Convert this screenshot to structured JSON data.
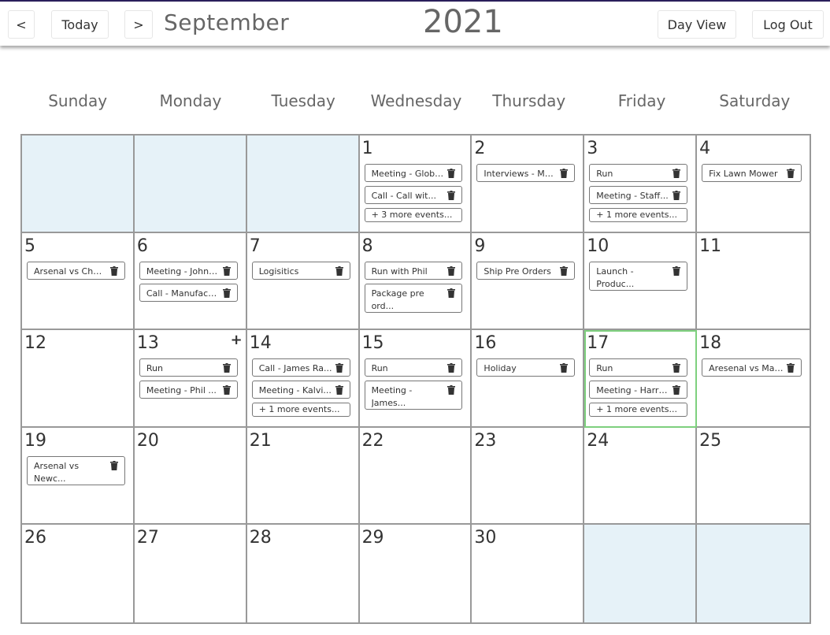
{
  "header": {
    "prev_label": "<",
    "today_label": "Today",
    "next_label": ">",
    "month": "September",
    "year": "2021",
    "day_view_label": "Day View",
    "logout_label": "Log Out"
  },
  "weekdays": [
    "Sunday",
    "Monday",
    "Tuesday",
    "Wednesday",
    "Thursday",
    "Friday",
    "Saturday"
  ],
  "colors": {
    "empty_cell": "#e6f2f8",
    "today_border": "#7ed07e",
    "header_line": "#2b1f5c"
  },
  "cells": [
    {
      "day": "",
      "empty": true,
      "events": []
    },
    {
      "day": "",
      "empty": true,
      "events": []
    },
    {
      "day": "",
      "empty": true,
      "events": []
    },
    {
      "day": "1",
      "events": [
        {
          "label": "Meeting - Globa..."
        },
        {
          "label": "Call - Call wit..."
        }
      ],
      "more": "+ 3 more events..."
    },
    {
      "day": "2",
      "events": [
        {
          "label": "Interviews - Me..."
        }
      ]
    },
    {
      "day": "3",
      "events": [
        {
          "label": "Run"
        },
        {
          "label": "Meeting - Staff..."
        }
      ],
      "more": "+ 1 more events..."
    },
    {
      "day": "4",
      "events": [
        {
          "label": "Fix Lawn Mower"
        }
      ]
    },
    {
      "day": "5",
      "events": [
        {
          "label": "Arsenal vs Chel..."
        }
      ]
    },
    {
      "day": "6",
      "events": [
        {
          "label": "Meeting - John ..."
        },
        {
          "label": "Call - Manufact..."
        }
      ]
    },
    {
      "day": "7",
      "events": [
        {
          "label": "Logisitics"
        }
      ]
    },
    {
      "day": "8",
      "events": [
        {
          "label": "Run with Phil"
        },
        {
          "label": "Package pre ord...",
          "tall": true
        }
      ]
    },
    {
      "day": "9",
      "events": [
        {
          "label": "Ship Pre Orders"
        }
      ]
    },
    {
      "day": "10",
      "events": [
        {
          "label": "Launch - Produc...",
          "tall": true
        }
      ]
    },
    {
      "day": "11",
      "events": []
    },
    {
      "day": "12",
      "events": []
    },
    {
      "day": "13",
      "add": "+",
      "events": [
        {
          "label": "Run"
        },
        {
          "label": "Meeting - Phil ..."
        }
      ]
    },
    {
      "day": "14",
      "events": [
        {
          "label": "Call - James Ra..."
        },
        {
          "label": "Meeting - Kalvi..."
        }
      ],
      "more": "+ 1 more events..."
    },
    {
      "day": "15",
      "events": [
        {
          "label": "Run"
        },
        {
          "label": "Meeting - James...",
          "tall": true
        }
      ]
    },
    {
      "day": "16",
      "events": [
        {
          "label": "Holiday"
        }
      ]
    },
    {
      "day": "17",
      "today": true,
      "events": [
        {
          "label": "Run"
        },
        {
          "label": "Meeting - Harry..."
        }
      ],
      "more": "+ 1 more events..."
    },
    {
      "day": "18",
      "events": [
        {
          "label": "Aresenal vs Man..."
        }
      ]
    },
    {
      "day": "19",
      "events": [
        {
          "label": "Arsenal vs Newc...",
          "tall": true
        }
      ]
    },
    {
      "day": "20",
      "events": []
    },
    {
      "day": "21",
      "events": []
    },
    {
      "day": "22",
      "events": []
    },
    {
      "day": "23",
      "events": []
    },
    {
      "day": "24",
      "events": []
    },
    {
      "day": "25",
      "events": []
    },
    {
      "day": "26",
      "events": []
    },
    {
      "day": "27",
      "events": []
    },
    {
      "day": "28",
      "events": []
    },
    {
      "day": "29",
      "events": []
    },
    {
      "day": "30",
      "events": []
    },
    {
      "day": "",
      "empty": true,
      "events": []
    },
    {
      "day": "",
      "empty": true,
      "events": []
    }
  ]
}
